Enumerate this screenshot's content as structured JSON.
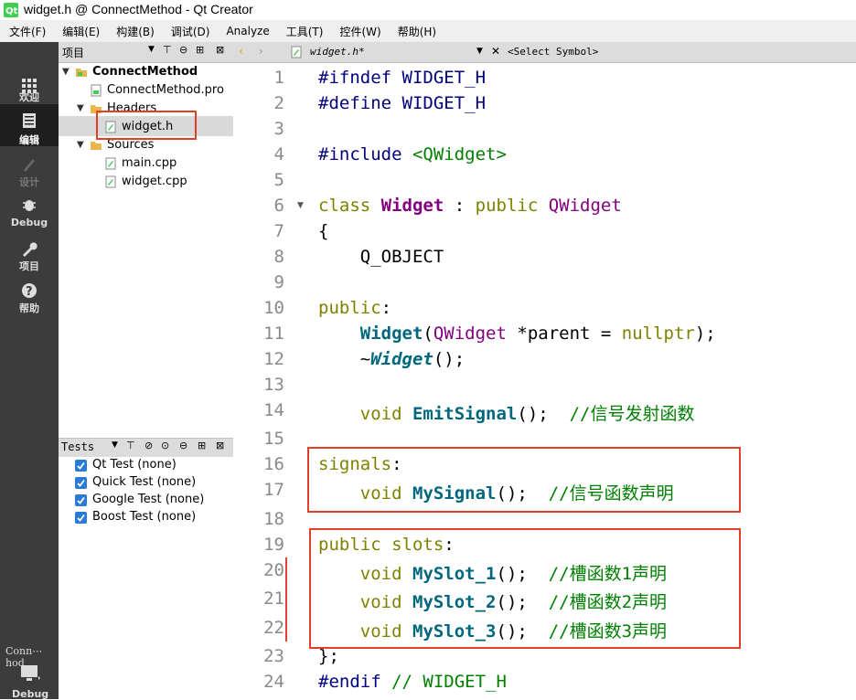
{
  "window": {
    "title": "widget.h @ ConnectMethod - Qt Creator"
  },
  "menu": [
    "文件(F)",
    "编辑(E)",
    "构建(B)",
    "调试(D)",
    "Analyze",
    "工具(T)",
    "控件(W)",
    "帮助(H)"
  ],
  "modes": [
    {
      "label": "欢迎",
      "icon": "welcome-grid-icon"
    },
    {
      "label": "编辑",
      "icon": "edit-document-icon"
    },
    {
      "label": "设计",
      "icon": "design-pen-icon"
    },
    {
      "label": "Debug",
      "icon": "debug-bug-icon"
    },
    {
      "label": "项目",
      "icon": "project-wrench-icon"
    },
    {
      "label": "帮助",
      "icon": "help-question-icon"
    }
  ],
  "project_pane": {
    "label": "项目",
    "tree": {
      "root": "ConnectMethod",
      "pro_file": "ConnectMethod.pro",
      "headers_folder": "Headers",
      "header_file": "widget.h",
      "sources_folder": "Sources",
      "source_files": [
        "main.cpp",
        "widget.cpp"
      ]
    }
  },
  "tests_pane": {
    "label": "Tests",
    "items": [
      "Qt Test (none)",
      "Quick Test (none)",
      "Google Test (none)",
      "Boost Test (none)"
    ]
  },
  "kit": {
    "project": "Conn⋯hod",
    "mode": "Debug"
  },
  "editor": {
    "file_tab": "widget.h*",
    "symbol": "<Select Symbol>",
    "line_numbers": [
      "1",
      "2",
      "3",
      "4",
      "5",
      "6",
      "7",
      "8",
      "9",
      "10",
      "11",
      "12",
      "13",
      "14",
      "15",
      "16",
      "17",
      "18",
      "19",
      "20",
      "21",
      "22",
      "23",
      "24"
    ],
    "code": {
      "l1": {
        "a": "#ifndef",
        "b": " WIDGET_H"
      },
      "l2": {
        "a": "#define",
        "b": " WIDGET_H"
      },
      "l4": {
        "a": "#include",
        "b": " <QWidget>"
      },
      "l6": {
        "a": "class",
        "b": "Widget",
        "c": " : ",
        "d": "public",
        "e": "QWidget"
      },
      "l7": "{",
      "l8": "    Q_OBJECT",
      "l10": {
        "a": "public",
        "b": ":"
      },
      "l11": {
        "a": "Widget",
        "b": "(",
        "c": "QWidget",
        "d": " *parent = ",
        "e": "nullptr",
        "f": ");"
      },
      "l12": {
        "a": "~",
        "b": "Widget",
        "c": "();"
      },
      "l14": {
        "a": "void",
        "b": "EmitSignal",
        "c": "();  ",
        "d": "//信号发射函数"
      },
      "l16": {
        "a": "signals",
        "b": ":"
      },
      "l17": {
        "a": "void",
        "b": "MySignal",
        "c": "();  ",
        "d": "//信号函数声明"
      },
      "l19": {
        "a": "public slots",
        "b": ":"
      },
      "l20": {
        "a": "void",
        "b": "MySlot_1",
        "c": "();  ",
        "d": "//槽函数1声明"
      },
      "l21": {
        "a": "void",
        "b": "MySlot_2",
        "c": "();  ",
        "d": "//槽函数2声明"
      },
      "l22": {
        "a": "void",
        "b": "MySlot_3",
        "c": "();  ",
        "d": "//槽函数3声明"
      },
      "l23": "};",
      "l24": {
        "a": "#endif",
        "b": " // WIDGET_H"
      }
    }
  },
  "colors": {
    "highlight_box": "#e0402a",
    "modebar_bg": "#3c3c3c",
    "keyword": "#808000",
    "type": "#800080",
    "function": "#00677c",
    "comment": "#008000"
  }
}
